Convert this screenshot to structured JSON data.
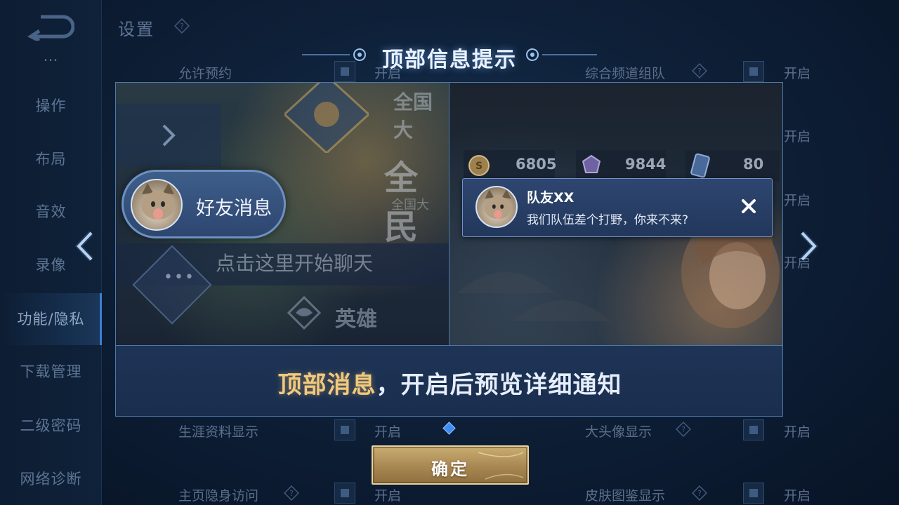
{
  "settings_page": {
    "title": "设置",
    "nav_items": [
      {
        "label": "…"
      },
      {
        "label": "操作"
      },
      {
        "label": "布局"
      },
      {
        "label": "音效"
      },
      {
        "label": "录像"
      },
      {
        "label": "功能/隐私"
      },
      {
        "label": "下载管理"
      },
      {
        "label": "二级密码"
      },
      {
        "label": "网络诊断"
      }
    ],
    "active_nav": "功能/隐私",
    "rows": [
      {
        "label": "允许预约",
        "value": "开启"
      },
      {
        "label": "综合频道组队",
        "value": "开启"
      },
      {
        "label": "",
        "value": "开启"
      },
      {
        "label": "",
        "value": "开启"
      },
      {
        "label": "",
        "value": "开启"
      },
      {
        "label": "生涯资料显示",
        "value": "开启"
      },
      {
        "label": "大头像显示",
        "value": "开启"
      },
      {
        "label": "主页隐身访问",
        "value": "开启"
      },
      {
        "label": "皮肤图鉴显示",
        "value": "开启"
      }
    ]
  },
  "modal": {
    "title": "顶部信息提示",
    "left_preview": {
      "banner_text": "全国大",
      "big_text": "全民",
      "sub_text": "全国大",
      "friend_pill_label": "好友消息",
      "chat_hint": "点击这里开始聊天",
      "hero_label": "英雄",
      "dots": "•••"
    },
    "right_preview": {
      "currencies": [
        "6805",
        "9844",
        "80"
      ],
      "notification": {
        "sender": "队友XX",
        "message": "我们队伍差个打野，你来不来?"
      }
    },
    "caption_highlight": "顶部消息",
    "caption_rest": "，开启后预览详细通知",
    "confirm_label": "确定"
  },
  "colors": {
    "accent_gold": "#f1c97e",
    "page_dot": "#3d8ef0",
    "panel_border": "#4f79aa"
  },
  "icons": [
    "back-arrow-icon",
    "help-icon",
    "chevron-left-icon",
    "chevron-right-icon",
    "close-icon",
    "coin-icon",
    "gem-icon",
    "card-icon"
  ]
}
